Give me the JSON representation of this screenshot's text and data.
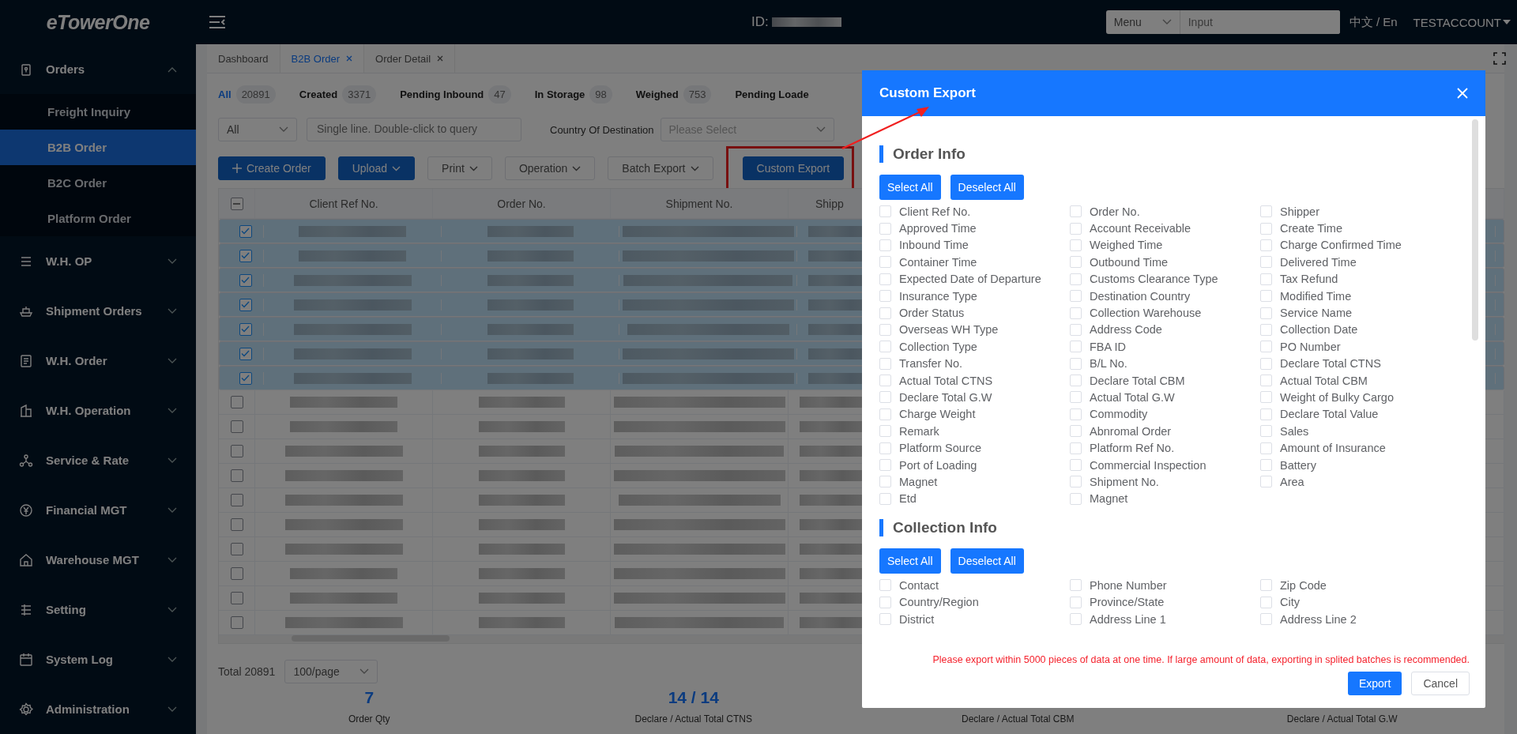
{
  "header": {
    "logo": "eTowerOne",
    "id_label": "ID:",
    "search": {
      "scope": "Menu",
      "placeholder": "Input"
    },
    "language": "中文 / En",
    "account": "TESTACCOUNT"
  },
  "sidebar": {
    "items": [
      {
        "label": "Orders",
        "expanded": true,
        "children": [
          {
            "label": "Freight Inquiry",
            "selected": false
          },
          {
            "label": "B2B Order",
            "selected": true
          },
          {
            "label": "B2C Order",
            "selected": false
          },
          {
            "label": "Platform Order",
            "selected": false
          }
        ]
      },
      {
        "label": "W.H. OP",
        "expanded": false
      },
      {
        "label": "Shipment Orders",
        "expanded": false
      },
      {
        "label": "W.H. Order",
        "expanded": false
      },
      {
        "label": "W.H. Operation",
        "expanded": false
      },
      {
        "label": "Service & Rate",
        "expanded": false
      },
      {
        "label": "Financial MGT",
        "expanded": false
      },
      {
        "label": "Warehouse MGT",
        "expanded": false
      },
      {
        "label": "Setting",
        "expanded": false
      },
      {
        "label": "System Log",
        "expanded": false
      },
      {
        "label": "Administration",
        "expanded": false
      }
    ]
  },
  "page_tabs": [
    {
      "label": "Dashboard",
      "selected": false,
      "closable": false
    },
    {
      "label": "B2B Order",
      "selected": true,
      "closable": true
    },
    {
      "label": "Order Detail",
      "selected": false,
      "closable": true
    }
  ],
  "status_tabs": [
    {
      "label": "All",
      "count": "20891",
      "selected": true
    },
    {
      "label": "Created",
      "count": "3371",
      "selected": false
    },
    {
      "label": "Pending Inbound",
      "count": "47",
      "selected": false
    },
    {
      "label": "In Storage",
      "count": "98",
      "selected": false
    },
    {
      "label": "Weighed",
      "count": "753",
      "selected": false
    },
    {
      "label": "Pending Loade",
      "selected": false
    }
  ],
  "filters": {
    "type_select": "All",
    "query_placeholder": "Single line. Double-click to query",
    "country_label": "Country Of Destination",
    "country_placeholder": "Please Select"
  },
  "toolbar": [
    {
      "label": "Create Order",
      "kind": "add",
      "dropdown": false,
      "highlighted": false
    },
    {
      "label": "Upload",
      "kind": "primary",
      "dropdown": true,
      "highlighted": false
    },
    {
      "label": "Print",
      "kind": "default",
      "dropdown": true,
      "highlighted": false
    },
    {
      "label": "Operation",
      "kind": "default",
      "dropdown": true,
      "highlighted": false
    },
    {
      "label": "Batch Export",
      "kind": "default",
      "dropdown": true,
      "highlighted": false
    },
    {
      "label": "Custom Export",
      "kind": "primary",
      "dropdown": false,
      "highlighted": true
    }
  ],
  "table": {
    "header_indeterminate": true,
    "columns": [
      "Client Ref No.",
      "Order No.",
      "Shipment No.",
      "Shipp"
    ],
    "rows": [
      {
        "selected": true
      },
      {
        "selected": true
      },
      {
        "selected": true
      },
      {
        "selected": true
      },
      {
        "selected": true
      },
      {
        "selected": true
      },
      {
        "selected": true
      },
      {
        "selected": false
      },
      {
        "selected": false
      },
      {
        "selected": false
      },
      {
        "selected": false
      },
      {
        "selected": false
      },
      {
        "selected": false
      },
      {
        "selected": false
      },
      {
        "selected": false
      },
      {
        "selected": false
      },
      {
        "selected": false
      }
    ]
  },
  "pagination": {
    "total": "Total 20891",
    "page_size": "100/page"
  },
  "summary": [
    {
      "value": "7",
      "label": "Order Qty"
    },
    {
      "value": "14 / 14",
      "label": "Declare / Actual Total CTNS"
    },
    {
      "label": "Declare / Actual Total CBM"
    },
    {
      "label": "Declare / Actual Total G.W"
    }
  ],
  "dialog": {
    "title": "Custom Export",
    "sections": [
      {
        "title": "Order Info",
        "select_all": "Select All",
        "deselect_all": "Deselect All",
        "fields": [
          {
            "label": "Client Ref No.",
            "checked": false
          },
          {
            "label": "Order No.",
            "checked": false
          },
          {
            "label": "Shipper",
            "checked": false
          },
          {
            "label": "Approved Time",
            "checked": false
          },
          {
            "label": "Account Receivable",
            "checked": false
          },
          {
            "label": "Create Time",
            "checked": false
          },
          {
            "label": "Inbound Time",
            "checked": false
          },
          {
            "label": "Weighed Time",
            "checked": false
          },
          {
            "label": "Charge Confirmed Time",
            "checked": false
          },
          {
            "label": "Container Time",
            "checked": false
          },
          {
            "label": "Outbound Time",
            "checked": false
          },
          {
            "label": "Delivered Time",
            "checked": false
          },
          {
            "label": "Expected Date of Departure",
            "checked": false
          },
          {
            "label": "Customs Clearance Type",
            "checked": false
          },
          {
            "label": "Tax Refund",
            "checked": false
          },
          {
            "label": "Insurance Type",
            "checked": false
          },
          {
            "label": "Destination Country",
            "checked": false
          },
          {
            "label": "Modified Time",
            "checked": false
          },
          {
            "label": "Order Status",
            "checked": false
          },
          {
            "label": "Collection Warehouse",
            "checked": false
          },
          {
            "label": "Service Name",
            "checked": false
          },
          {
            "label": "Overseas WH Type",
            "checked": false
          },
          {
            "label": "Address Code",
            "checked": false
          },
          {
            "label": "Collection Date",
            "checked": false
          },
          {
            "label": "Collection Type",
            "checked": false
          },
          {
            "label": "FBA ID",
            "checked": false
          },
          {
            "label": "PO Number",
            "checked": false
          },
          {
            "label": "Transfer No.",
            "checked": false
          },
          {
            "label": "B/L No.",
            "checked": false
          },
          {
            "label": "Declare Total CTNS",
            "checked": false
          },
          {
            "label": "Actual Total CTNS",
            "checked": false
          },
          {
            "label": "Declare Total CBM",
            "checked": false
          },
          {
            "label": "Actual Total CBM",
            "checked": false
          },
          {
            "label": "Declare Total G.W",
            "checked": false
          },
          {
            "label": "Actual Total G.W",
            "checked": false
          },
          {
            "label": "Weight of Bulky Cargo",
            "checked": false
          },
          {
            "label": "Charge Weight",
            "checked": false
          },
          {
            "label": "Commodity",
            "checked": false
          },
          {
            "label": "Declare Total Value",
            "checked": false
          },
          {
            "label": "Remark",
            "checked": false
          },
          {
            "label": "Abnromal Order",
            "checked": false
          },
          {
            "label": "Sales",
            "checked": false
          },
          {
            "label": "Platform Source",
            "checked": false
          },
          {
            "label": "Platform Ref No.",
            "checked": false
          },
          {
            "label": "Amount of Insurance",
            "checked": false
          },
          {
            "label": "Port of Loading",
            "checked": false
          },
          {
            "label": "Commercial Inspection",
            "checked": false
          },
          {
            "label": "Battery",
            "checked": false
          },
          {
            "label": "Magnet",
            "checked": false
          },
          {
            "label": "Shipment No.",
            "checked": false
          },
          {
            "label": "Area",
            "checked": false
          },
          {
            "label": "Etd",
            "checked": false
          },
          {
            "label": "Magnet",
            "checked": false
          }
        ]
      },
      {
        "title": "Collection Info",
        "select_all": "Select All",
        "deselect_all": "Deselect All",
        "fields": [
          {
            "label": "Contact",
            "checked": false
          },
          {
            "label": "Phone Number",
            "checked": false
          },
          {
            "label": "Zip Code",
            "checked": false
          },
          {
            "label": "Country/Region",
            "checked": false
          },
          {
            "label": "Province/State",
            "checked": false
          },
          {
            "label": "City",
            "checked": false
          },
          {
            "label": "District",
            "checked": false
          },
          {
            "label": "Address Line 1",
            "checked": false
          },
          {
            "label": "Address Line 2",
            "checked": false
          }
        ]
      }
    ],
    "note": "Please export within 5000 pieces of data at one time. If large amount of data, exporting in splited batches is recommended.",
    "buttons": [
      {
        "label": "Export",
        "kind": "primary"
      },
      {
        "label": "Cancel",
        "kind": "default"
      }
    ]
  }
}
